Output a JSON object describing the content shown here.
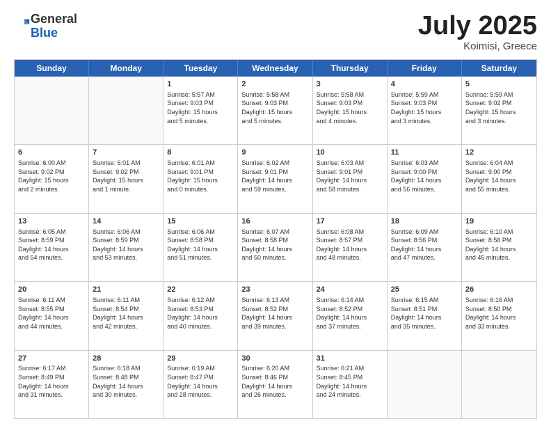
{
  "header": {
    "logo_general": "General",
    "logo_blue": "Blue",
    "month_title": "July 2025",
    "location": "Koimisi, Greece"
  },
  "weekdays": [
    "Sunday",
    "Monday",
    "Tuesday",
    "Wednesday",
    "Thursday",
    "Friday",
    "Saturday"
  ],
  "rows": [
    [
      {
        "day": "",
        "lines": [],
        "empty": true
      },
      {
        "day": "",
        "lines": [],
        "empty": true
      },
      {
        "day": "1",
        "lines": [
          "Sunrise: 5:57 AM",
          "Sunset: 9:03 PM",
          "Daylight: 15 hours",
          "and 5 minutes."
        ],
        "empty": false
      },
      {
        "day": "2",
        "lines": [
          "Sunrise: 5:58 AM",
          "Sunset: 9:03 PM",
          "Daylight: 15 hours",
          "and 5 minutes."
        ],
        "empty": false
      },
      {
        "day": "3",
        "lines": [
          "Sunrise: 5:58 AM",
          "Sunset: 9:03 PM",
          "Daylight: 15 hours",
          "and 4 minutes."
        ],
        "empty": false
      },
      {
        "day": "4",
        "lines": [
          "Sunrise: 5:59 AM",
          "Sunset: 9:03 PM",
          "Daylight: 15 hours",
          "and 3 minutes."
        ],
        "empty": false
      },
      {
        "day": "5",
        "lines": [
          "Sunrise: 5:59 AM",
          "Sunset: 9:02 PM",
          "Daylight: 15 hours",
          "and 3 minutes."
        ],
        "empty": false
      }
    ],
    [
      {
        "day": "6",
        "lines": [
          "Sunrise: 6:00 AM",
          "Sunset: 9:02 PM",
          "Daylight: 15 hours",
          "and 2 minutes."
        ],
        "empty": false
      },
      {
        "day": "7",
        "lines": [
          "Sunrise: 6:01 AM",
          "Sunset: 9:02 PM",
          "Daylight: 15 hours",
          "and 1 minute."
        ],
        "empty": false
      },
      {
        "day": "8",
        "lines": [
          "Sunrise: 6:01 AM",
          "Sunset: 9:01 PM",
          "Daylight: 15 hours",
          "and 0 minutes."
        ],
        "empty": false
      },
      {
        "day": "9",
        "lines": [
          "Sunrise: 6:02 AM",
          "Sunset: 9:01 PM",
          "Daylight: 14 hours",
          "and 59 minutes."
        ],
        "empty": false
      },
      {
        "day": "10",
        "lines": [
          "Sunrise: 6:03 AM",
          "Sunset: 9:01 PM",
          "Daylight: 14 hours",
          "and 58 minutes."
        ],
        "empty": false
      },
      {
        "day": "11",
        "lines": [
          "Sunrise: 6:03 AM",
          "Sunset: 9:00 PM",
          "Daylight: 14 hours",
          "and 56 minutes."
        ],
        "empty": false
      },
      {
        "day": "12",
        "lines": [
          "Sunrise: 6:04 AM",
          "Sunset: 9:00 PM",
          "Daylight: 14 hours",
          "and 55 minutes."
        ],
        "empty": false
      }
    ],
    [
      {
        "day": "13",
        "lines": [
          "Sunrise: 6:05 AM",
          "Sunset: 8:59 PM",
          "Daylight: 14 hours",
          "and 54 minutes."
        ],
        "empty": false
      },
      {
        "day": "14",
        "lines": [
          "Sunrise: 6:06 AM",
          "Sunset: 8:59 PM",
          "Daylight: 14 hours",
          "and 53 minutes."
        ],
        "empty": false
      },
      {
        "day": "15",
        "lines": [
          "Sunrise: 6:06 AM",
          "Sunset: 8:58 PM",
          "Daylight: 14 hours",
          "and 51 minutes."
        ],
        "empty": false
      },
      {
        "day": "16",
        "lines": [
          "Sunrise: 6:07 AM",
          "Sunset: 8:58 PM",
          "Daylight: 14 hours",
          "and 50 minutes."
        ],
        "empty": false
      },
      {
        "day": "17",
        "lines": [
          "Sunrise: 6:08 AM",
          "Sunset: 8:57 PM",
          "Daylight: 14 hours",
          "and 48 minutes."
        ],
        "empty": false
      },
      {
        "day": "18",
        "lines": [
          "Sunrise: 6:09 AM",
          "Sunset: 8:56 PM",
          "Daylight: 14 hours",
          "and 47 minutes."
        ],
        "empty": false
      },
      {
        "day": "19",
        "lines": [
          "Sunrise: 6:10 AM",
          "Sunset: 8:56 PM",
          "Daylight: 14 hours",
          "and 45 minutes."
        ],
        "empty": false
      }
    ],
    [
      {
        "day": "20",
        "lines": [
          "Sunrise: 6:11 AM",
          "Sunset: 8:55 PM",
          "Daylight: 14 hours",
          "and 44 minutes."
        ],
        "empty": false
      },
      {
        "day": "21",
        "lines": [
          "Sunrise: 6:11 AM",
          "Sunset: 8:54 PM",
          "Daylight: 14 hours",
          "and 42 minutes."
        ],
        "empty": false
      },
      {
        "day": "22",
        "lines": [
          "Sunrise: 6:12 AM",
          "Sunset: 8:53 PM",
          "Daylight: 14 hours",
          "and 40 minutes."
        ],
        "empty": false
      },
      {
        "day": "23",
        "lines": [
          "Sunrise: 6:13 AM",
          "Sunset: 8:52 PM",
          "Daylight: 14 hours",
          "and 39 minutes."
        ],
        "empty": false
      },
      {
        "day": "24",
        "lines": [
          "Sunrise: 6:14 AM",
          "Sunset: 8:52 PM",
          "Daylight: 14 hours",
          "and 37 minutes."
        ],
        "empty": false
      },
      {
        "day": "25",
        "lines": [
          "Sunrise: 6:15 AM",
          "Sunset: 8:51 PM",
          "Daylight: 14 hours",
          "and 35 minutes."
        ],
        "empty": false
      },
      {
        "day": "26",
        "lines": [
          "Sunrise: 6:16 AM",
          "Sunset: 8:50 PM",
          "Daylight: 14 hours",
          "and 33 minutes."
        ],
        "empty": false
      }
    ],
    [
      {
        "day": "27",
        "lines": [
          "Sunrise: 6:17 AM",
          "Sunset: 8:49 PM",
          "Daylight: 14 hours",
          "and 31 minutes."
        ],
        "empty": false
      },
      {
        "day": "28",
        "lines": [
          "Sunrise: 6:18 AM",
          "Sunset: 8:48 PM",
          "Daylight: 14 hours",
          "and 30 minutes."
        ],
        "empty": false
      },
      {
        "day": "29",
        "lines": [
          "Sunrise: 6:19 AM",
          "Sunset: 8:47 PM",
          "Daylight: 14 hours",
          "and 28 minutes."
        ],
        "empty": false
      },
      {
        "day": "30",
        "lines": [
          "Sunrise: 6:20 AM",
          "Sunset: 8:46 PM",
          "Daylight: 14 hours",
          "and 26 minutes."
        ],
        "empty": false
      },
      {
        "day": "31",
        "lines": [
          "Sunrise: 6:21 AM",
          "Sunset: 8:45 PM",
          "Daylight: 14 hours",
          "and 24 minutes."
        ],
        "empty": false
      },
      {
        "day": "",
        "lines": [],
        "empty": true
      },
      {
        "day": "",
        "lines": [],
        "empty": true
      }
    ]
  ]
}
